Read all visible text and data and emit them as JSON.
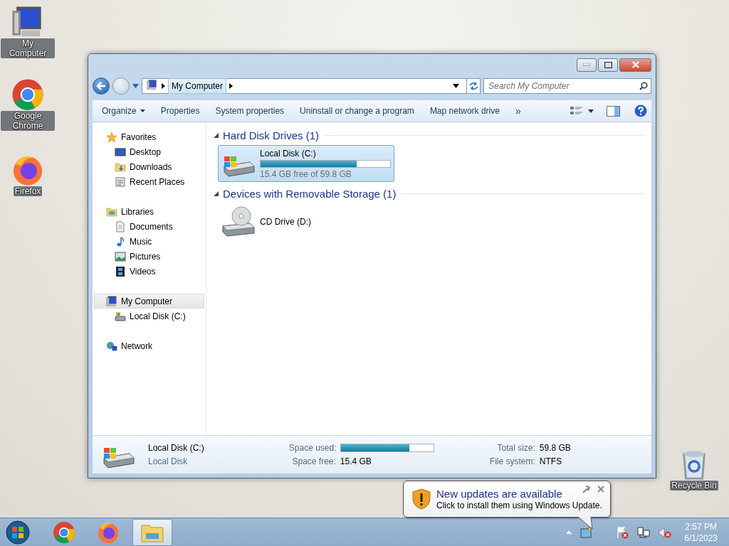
{
  "desktop_icons": [
    {
      "label": "My Computer",
      "kind": "computer"
    },
    {
      "label": "Google Chrome",
      "kind": "chrome"
    },
    {
      "label": "Firefox",
      "kind": "firefox"
    },
    {
      "label": "Recycle Bin",
      "kind": "recycle"
    }
  ],
  "window": {
    "address": {
      "crumbs": [
        "My Computer"
      ]
    },
    "search": {
      "placeholder": "Search My Computer"
    },
    "toolbar": [
      {
        "label": "Organize",
        "kind": "menu"
      },
      {
        "label": "Properties",
        "kind": "plain"
      },
      {
        "label": "System properties",
        "kind": "plain"
      },
      {
        "label": "Uninstall or change a program",
        "kind": "plain"
      },
      {
        "label": "Map network drive",
        "kind": "plain"
      },
      {
        "label": "»",
        "kind": "more"
      }
    ],
    "sidebar": [
      {
        "label": "Favorites",
        "kind": "favorites",
        "selected": false,
        "children": [
          {
            "label": "Desktop",
            "kind": "desktop",
            "selected": false
          },
          {
            "label": "Downloads",
            "kind": "downloads",
            "selected": false
          },
          {
            "label": "Recent Places",
            "kind": "recent",
            "selected": false
          }
        ]
      },
      {
        "label": "Libraries",
        "kind": "libraries",
        "selected": false,
        "children": [
          {
            "label": "Documents",
            "kind": "documents",
            "selected": false
          },
          {
            "label": "Music",
            "kind": "music",
            "selected": false
          },
          {
            "label": "Pictures",
            "kind": "pictures",
            "selected": false
          },
          {
            "label": "Videos",
            "kind": "videos",
            "selected": false
          }
        ]
      },
      {
        "label": "My Computer",
        "kind": "computer",
        "selected": true,
        "children": [
          {
            "label": "Local Disk (C:)",
            "kind": "disk",
            "selected": false
          }
        ]
      },
      {
        "label": "Network",
        "kind": "network",
        "selected": false
      }
    ],
    "sections": [
      {
        "title": "Hard Disk Drives (1)",
        "expanded": true,
        "items": [
          {
            "name": "Local Disk (C:)",
            "kind": "hdd",
            "selected": true,
            "level": 0.74,
            "reading": "15.4 GB free of 59.8 GB"
          }
        ]
      },
      {
        "title": "Devices with Removable Storage (1)",
        "expanded": true,
        "items": [
          {
            "name": "CD Drive (D:)",
            "kind": "cd",
            "selected": false
          }
        ]
      }
    ],
    "details": {
      "name": "Local Disk (C:)",
      "type": "Local Disk",
      "used_label": "Space used:",
      "level": 0.74,
      "free_label": "Space free:",
      "free": "15.4 GB",
      "total_label": "Total size:",
      "total": "59.8 GB",
      "fs_label": "File system:",
      "fs": "NTFS"
    }
  },
  "notification": {
    "title": "New updates are available",
    "message": "Click to install them using Windows Update."
  },
  "taskbar": {
    "apps": [
      {
        "kind": "chrome",
        "active": false
      },
      {
        "kind": "firefox",
        "active": false
      },
      {
        "kind": "explorer",
        "active": true
      }
    ],
    "time": "2:57 PM",
    "date": "6/1/2023"
  }
}
